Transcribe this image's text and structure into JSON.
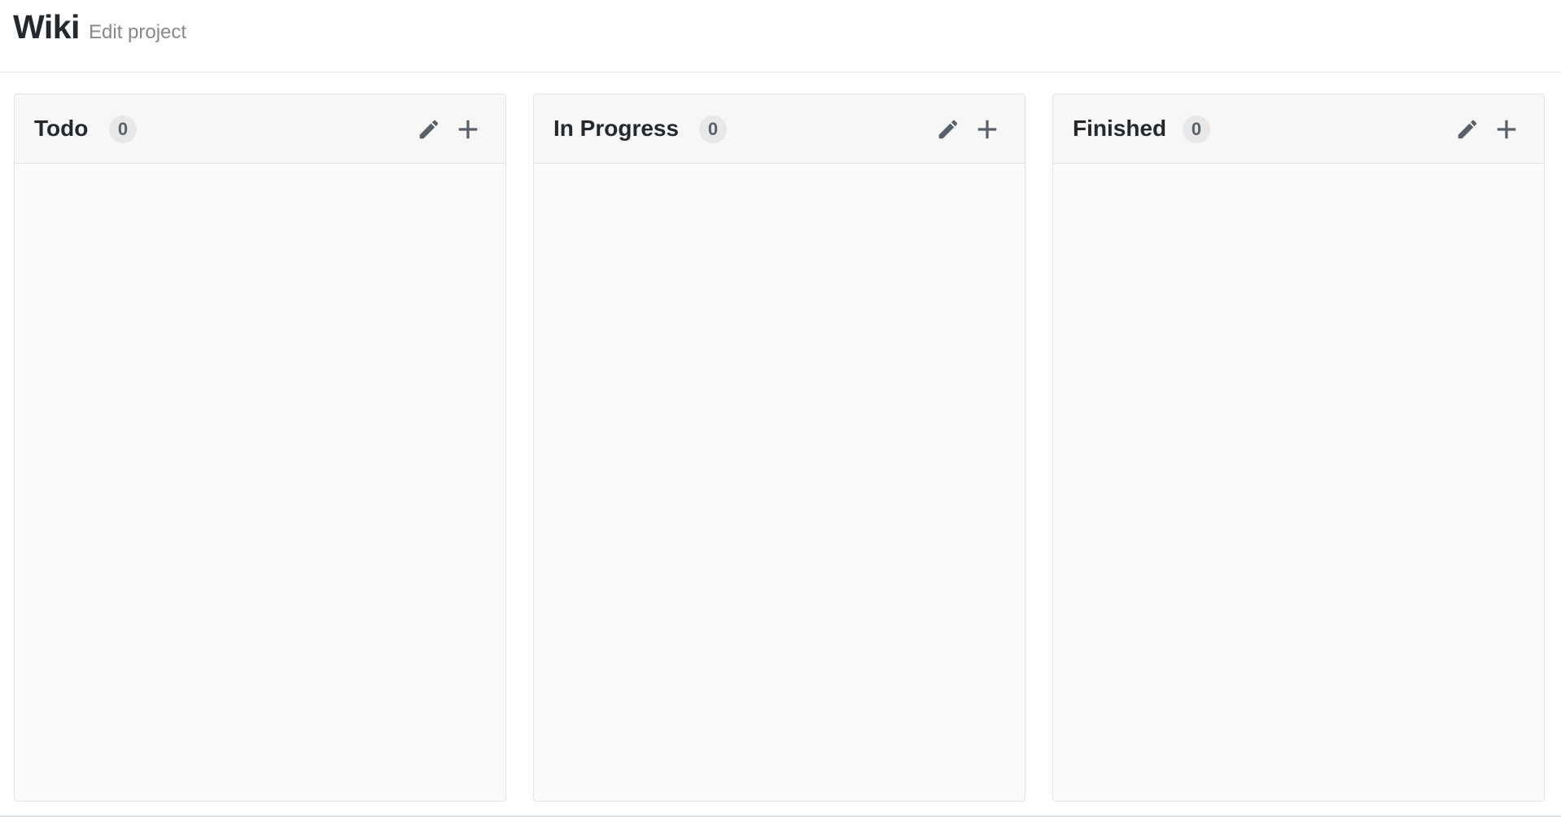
{
  "header": {
    "title": "Wiki",
    "edit_label": "Edit project"
  },
  "columns": [
    {
      "name": "Todo",
      "count": "0"
    },
    {
      "name": "In Progress",
      "count": "0"
    },
    {
      "name": "Finished",
      "count": "0"
    }
  ],
  "icons": {
    "edit": "pencil-icon",
    "add": "plus-icon"
  },
  "colors": {
    "column_background": "#fafafa",
    "border": "#e1e4e8",
    "icon": "#586069",
    "counter_background": "#e8e8e8"
  }
}
